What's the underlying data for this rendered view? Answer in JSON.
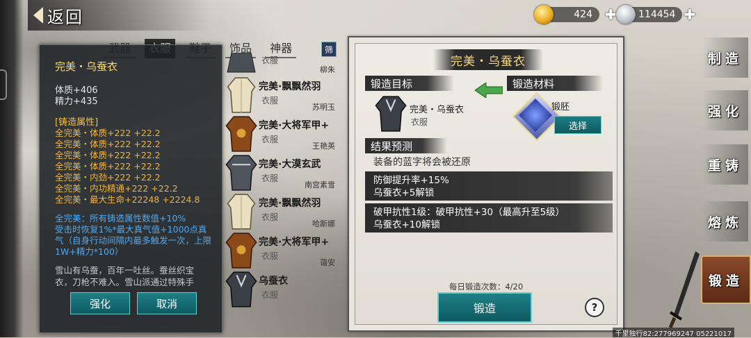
{
  "header": {
    "back_label": "返回"
  },
  "currency": {
    "gold": {
      "icon": "gold-ingot-icon",
      "value": "424"
    },
    "silver": {
      "icon": "silver-ingot-icon",
      "value": "114454"
    }
  },
  "tabs": [
    {
      "label": "武器",
      "active": false
    },
    {
      "label": "衣服",
      "active": true
    },
    {
      "label": "鞋子",
      "active": false
    },
    {
      "label": "饰品",
      "active": false
    },
    {
      "label": "神器",
      "active": false
    }
  ],
  "filter_label": "筛",
  "item_list": [
    {
      "name": "",
      "type": "衣服",
      "owner": "柳朱"
    },
    {
      "name": "完美·飘飘然羽",
      "type": "衣服",
      "owner": "苏明玉"
    },
    {
      "name": "完美·大将军甲+",
      "type": "衣服",
      "owner": "王艳英"
    },
    {
      "name": "完美·大漠玄武",
      "type": "衣服",
      "owner": "南宫素雪"
    },
    {
      "name": "完美·飘飘然羽",
      "type": "衣服",
      "owner": "哈斯娜"
    },
    {
      "name": "完美·大将军甲+",
      "type": "衣服",
      "owner": "蔼安"
    },
    {
      "name": "乌蚕衣",
      "type": "衣服",
      "owner": ""
    }
  ],
  "detail": {
    "title": "完美・乌蚕衣",
    "stats": [
      "体质+406",
      "精力+435"
    ],
    "section_title": "[铸造属性]",
    "attributes": [
      "全完美・体质+222  +22.2",
      "全完美・体质+222  +22.2",
      "全完美・体质+222  +22.2",
      "全完美・体质+222  +22.2",
      "全完美・内劲+222  +22.2",
      "全完美・内功精通+222  +22.2",
      "全完美・最大生命+22248  +2224.8"
    ],
    "set_bonus": "全完美：所有铸造属性数值+10%\n受击时恢复1%*最大真气值+1000点真气（自身行动间隔内最多触发一次，上限1W+精力*100）",
    "description": "雪山有乌蚕，百年一吐丝。蚕丝织宝衣，刀枪不难入。雪山派通过特殊手",
    "btn_enhance": "强化",
    "btn_cancel": "取消"
  },
  "forge": {
    "title": "完美・乌蚕衣",
    "target_label": "锻造目标",
    "target_name": "完美・乌蚕衣",
    "target_type": "衣服",
    "material_label": "锻造材料",
    "material_name": "锻胚",
    "select_label": "选择",
    "predict_label": "结果预测",
    "predict_text": "装备的蓝字将会被还原",
    "bonuses": [
      {
        "line1": "防御提升率+15%",
        "line2": "乌蚕衣+5解锁"
      },
      {
        "line1": "破甲抗性1级：破甲抗性+30（最高升至5级）",
        "line2": "乌蚕衣+10解锁"
      }
    ],
    "daily_count": "每日锻造次数：4/20",
    "forge_button": "锻造",
    "help": "?"
  },
  "right_menu": [
    {
      "label": "制造",
      "active": false
    },
    {
      "label": "强化",
      "active": false
    },
    {
      "label": "重铸",
      "active": false
    },
    {
      "label": "熔炼",
      "active": false
    },
    {
      "label": "锻造",
      "active": true
    }
  ],
  "footer": "千里独行82:277969247 05221017",
  "colors": {
    "accent_teal": "#1f8088",
    "gold_text": "#f5d97a",
    "attr_orange": "#f1b43a",
    "set_blue": "#4fa8f0"
  }
}
